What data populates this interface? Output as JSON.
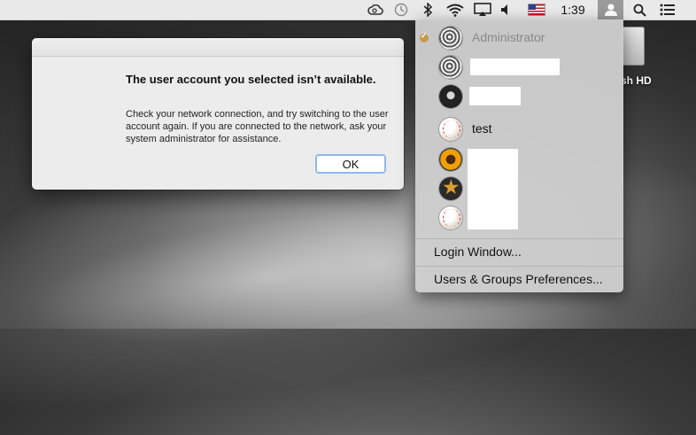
{
  "menubar": {
    "clock": "1:39",
    "icons": [
      "creative-cloud-icon",
      "time-machine-icon",
      "bluetooth-icon",
      "wifi-icon",
      "airplay-icon",
      "volume-icon",
      "input-flag-us-icon",
      "user-icon",
      "spotlight-icon",
      "notification-center-icon"
    ]
  },
  "desktop": {
    "disk_label": "sh HD"
  },
  "dialog": {
    "title": "The user account you selected isn’t available.",
    "message": "Check your network connection, and try switching to the user account again. If you are connected to the network, ask your system administrator for assistance.",
    "ok_label": "OK"
  },
  "user_menu": {
    "current_user": "Administrator",
    "users": [
      {
        "name": "Administrator",
        "avatar": "swirl",
        "current": true
      },
      {
        "name": "",
        "avatar": "swirl"
      },
      {
        "name": "",
        "avatar": "dark"
      },
      {
        "name": "test",
        "avatar": "baseball"
      },
      {
        "name": "",
        "avatar": "sunflower"
      },
      {
        "name": "",
        "avatar": "starfish"
      },
      {
        "name": "",
        "avatar": "baseball"
      }
    ],
    "login_window_label": "Login Window...",
    "preferences_label": "Users & Groups Preferences..."
  }
}
